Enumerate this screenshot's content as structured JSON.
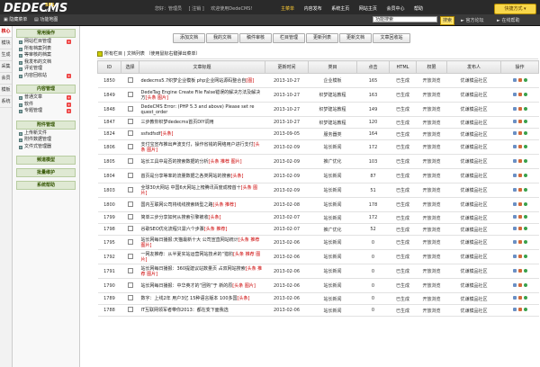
{
  "header": {
    "logo": "DEDECMS",
    "version_top": "SP1",
    "version": "v5.7",
    "top_links": [
      "您好：管理员 ",
      "[ 注销 ]",
      "欢迎使用DedeCMS!"
    ],
    "nav": [
      "主菜单",
      "内容发布",
      "系统主页",
      "网站主页",
      "会员中心",
      "帮助"
    ],
    "quick_button": "快捷方式 ▾"
  },
  "toolbar": {
    "hide_menu": "隐藏菜单",
    "func_map": "功能地图",
    "search_placeholder": "功能搜索",
    "search_button": "搜索",
    "official_forum": "官方论坛",
    "online_help": "在线帮助"
  },
  "sidebar_tabs": [
    "核心",
    "模块",
    "生成",
    "采集",
    "会员",
    "模板",
    "系统"
  ],
  "sidebar": {
    "groups": [
      {
        "title": "常用操作",
        "items": [
          {
            "label": "网站栏目管理",
            "plus": true
          },
          {
            "label": "所有档案列表",
            "plus": false
          },
          {
            "label": "等审核的档案",
            "plus": false
          },
          {
            "label": "我发布的文档",
            "plus": false
          },
          {
            "label": "评论管理",
            "plus": false
          },
          {
            "label": "内容回收站",
            "plus": true
          }
        ]
      },
      {
        "title": "内容管理",
        "items": [
          {
            "label": "普通文章",
            "plus": true
          },
          {
            "label": "软件",
            "plus": true
          },
          {
            "label": "专题管理",
            "plus": true
          }
        ]
      },
      {
        "title": "附件管理",
        "items": [
          {
            "label": "上传新文件",
            "plus": false
          },
          {
            "label": "附件数据管理",
            "plus": false
          },
          {
            "label": "文件式管理器",
            "plus": false
          }
        ]
      },
      {
        "title": "频道模型",
        "items": []
      },
      {
        "title": "批量维护",
        "items": []
      },
      {
        "title": "系统帮助",
        "items": []
      }
    ]
  },
  "action_buttons": [
    "添加文档",
    "我的文档",
    "稿件审核",
    "栏目管理",
    "更新列表",
    "更新文档",
    "文章回收站"
  ],
  "list_title": "所有栏目 | 文档列表    （使用鼠标右键弹出菜单）",
  "columns": [
    "ID",
    "选择",
    "文章标题",
    "更新时间",
    "类目",
    "点击",
    "HTML",
    "权限",
    "发布人",
    "操作"
  ],
  "rows": [
    {
      "id": "1850",
      "title": "dedecms5.7织梦企业模板 php企业网站源码整合自",
      "tag": "[图]",
      "date": "2013-10-27",
      "cat": "企业模板",
      "hits": "165",
      "html": "已生成",
      "perm": "开放浏览",
      "author": "优谦模品社区"
    },
    {
      "id": "1849",
      "title": "DedeTag Engine Create File False错误的解决方法及解决方",
      "tag": "[头条 图片]",
      "date": "2013-10-27",
      "cat": "织梦建站教程",
      "hits": "163",
      "html": "已生成",
      "perm": "开放浏览",
      "author": "优谦模品社区"
    },
    {
      "id": "1848",
      "title": "DedeCMS Error: (PHP 5.3 and above) Please set re quest_order",
      "tag": "",
      "date": "2013-10-27",
      "cat": "织梦建站教程",
      "hits": "149",
      "html": "已生成",
      "perm": "开放浏览",
      "author": "优谦模品社区"
    },
    {
      "id": "1847",
      "title": "三步教你织梦dedecms首页DIY调用",
      "tag": "",
      "date": "2013-10-27",
      "cat": "织梦建站教程",
      "hits": "120",
      "html": "已生成",
      "perm": "开放浏览",
      "author": "优谦模品社区"
    },
    {
      "id": "1824",
      "title": "ssfsdfsdf",
      "tag": "[头条]",
      "date": "2013-09-05",
      "cat": "服务器类",
      "hits": "164",
      "html": "已生成",
      "perm": "开放浏览",
      "author": "优谦模品社区"
    },
    {
      "id": "1806",
      "title": "支付宝宣布推出声波支付，操作省钱的网络用户进行支付",
      "tag": "[头条 图片]",
      "date": "2013-02-09",
      "cat": "站长新闻",
      "hits": "172",
      "html": "已生成",
      "perm": "开放浏览",
      "author": "优谦模品社区"
    },
    {
      "id": "1805",
      "title": "站长工具中是否的搜索数据的分析",
      "tag": "[头条 推荐 图片]",
      "date": "2013-02-09",
      "cat": "推广优化",
      "hits": "103",
      "html": "已生成",
      "perm": "开放浏览",
      "author": "优谦模品社区"
    },
    {
      "id": "1804",
      "title": "首页是分享等率的流量数据之各类网站的搜索",
      "tag": "[头条]",
      "date": "2013-02-09",
      "cat": "站长新闻",
      "hits": "87",
      "html": "已生成",
      "perm": "开放浏览",
      "author": "优谦模品社区"
    },
    {
      "id": "1803",
      "title": "全球30大网站 中国6大网站上榜腾讯百度成榜首十",
      "tag": "[头条 图片]",
      "date": "2013-02-09",
      "cat": "站长新闻",
      "hits": "51",
      "html": "已生成",
      "perm": "开放浏览",
      "author": "优谦模品社区"
    },
    {
      "id": "1800",
      "title": "国内互联网公司将线线搜索转型之路",
      "tag": "[头条 推荐]",
      "date": "2013-02-08",
      "cat": "站长新闻",
      "hits": "178",
      "html": "已生成",
      "perm": "开放浏览",
      "author": "优谦模品社区"
    },
    {
      "id": "1799",
      "title": "简单三步分享如何从搜索引擎被收",
      "tag": "[头条]",
      "date": "2013-02-07",
      "cat": "站长新闻",
      "hits": "172",
      "html": "已生成",
      "perm": "开放浏览",
      "author": "优谦模品社区"
    },
    {
      "id": "1798",
      "title": "谷歌SEO优化流程只需六个步骤",
      "tag": "[头条 推荐]",
      "date": "2013-02-07",
      "cat": "推广优化",
      "hits": "52",
      "html": "已生成",
      "perm": "开放浏览",
      "author": "优谦模品社区"
    },
    {
      "id": "1795",
      "title": "站长网每日播报:天猫最新十大 公司宣直网站统计",
      "tag": "[头条 推荐 图片]",
      "date": "2013-02-06",
      "cat": "站长新闻",
      "hits": "0",
      "html": "已生成",
      "perm": "开放浏览",
      "author": "优谦模品社区"
    },
    {
      "id": "1792",
      "title": "一网友推荐：从半夏实站运营网站技术的“猎豹",
      "tag": "[头条 推荐 图片]",
      "date": "2013-02-06",
      "cat": "站长新闻",
      "hits": "0",
      "html": "已生成",
      "perm": "开放浏览",
      "author": "优谦模品社区"
    },
    {
      "id": "1791",
      "title": "站长网每日播报：360提建议站数量页 占双网站搜索",
      "tag": "[头条 推荐 图片]",
      "date": "2013-02-06",
      "cat": "站长新闻",
      "hits": "0",
      "html": "已生成",
      "perm": "开放浏览",
      "author": "优谦模品社区"
    },
    {
      "id": "1790",
      "title": "站长网每日播报：中华英才的“团购”于 新的原",
      "tag": "[头条 图片]",
      "date": "2013-02-06",
      "cat": "站长新闻",
      "hits": "0",
      "html": "已生成",
      "perm": "开放浏览",
      "author": "优谦模品社区"
    },
    {
      "id": "1789",
      "title": "数字：上线2年 用户3亿 15种语言版本 100多国",
      "tag": "[头条]",
      "date": "2013-02-06",
      "cat": "站长新闻",
      "hits": "0",
      "html": "已生成",
      "perm": "开放浏览",
      "author": "优谦模品社区"
    },
    {
      "id": "1788",
      "title": "IT互联网领军者带你2013：都在变下面我选",
      "tag": "",
      "date": "2013-02-06",
      "cat": "站长新闻",
      "hits": "0",
      "html": "已生成",
      "perm": "开放浏览",
      "author": "优谦模品社区"
    }
  ]
}
